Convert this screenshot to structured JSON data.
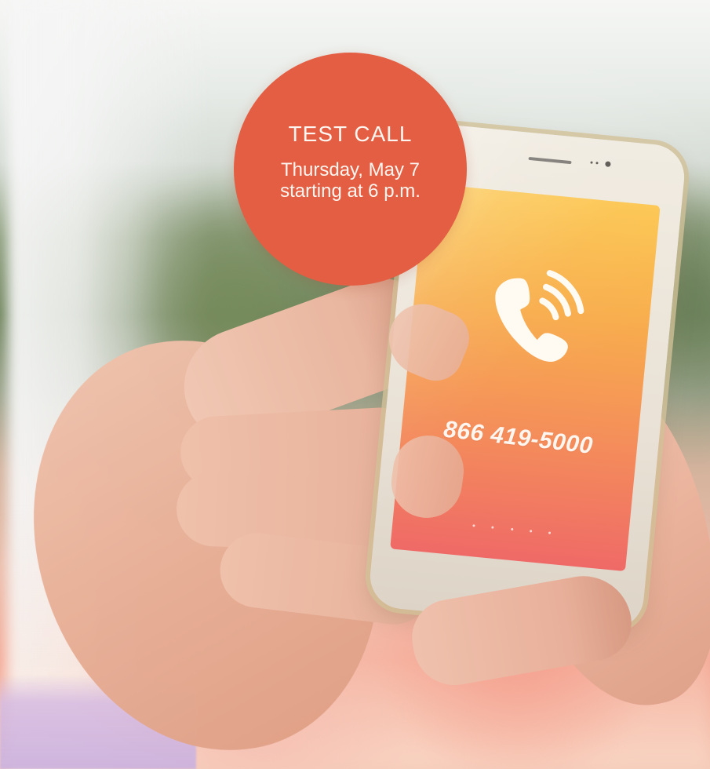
{
  "promo": {
    "title": "TEST CALL",
    "date_line": "Thursday, May 7",
    "time_line": "starting at 6 p.m."
  },
  "phone_screen": {
    "number": "866 419-5000",
    "icon": "phone-call-icon"
  },
  "colors": {
    "badge": "#e35e42",
    "screen_top": "#fcc650",
    "screen_bottom": "#ef6a67",
    "text_light": "#fff6f0"
  }
}
